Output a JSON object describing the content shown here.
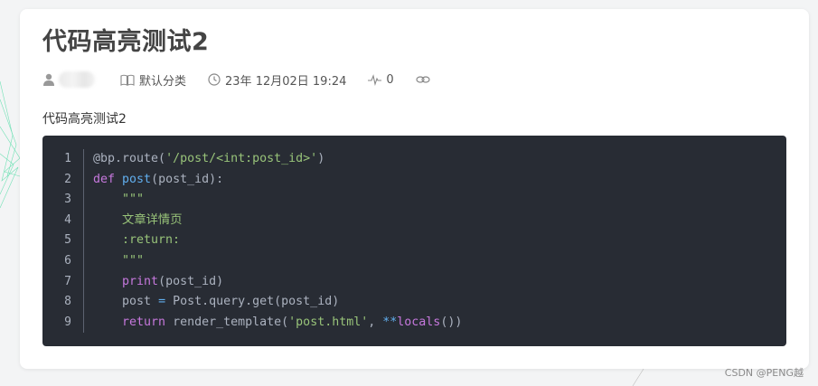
{
  "article": {
    "title": "代码高亮测试2",
    "summary": "代码高亮测试2"
  },
  "meta": {
    "category": "默认分类",
    "datetime": "23年 12月02日 19:24",
    "views": "0"
  },
  "code": {
    "line_numbers": [
      "1",
      "2",
      "3",
      "4",
      "5",
      "6",
      "7",
      "8",
      "9"
    ],
    "lines": [
      [
        {
          "t": "@bp.route(",
          "c": "default"
        },
        {
          "t": "'/post/<int:post_id>'",
          "c": "string"
        },
        {
          "t": ")",
          "c": "default"
        }
      ],
      [
        {
          "t": "def ",
          "c": "keyword"
        },
        {
          "t": "post",
          "c": "func"
        },
        {
          "t": "(post_id):",
          "c": "default"
        }
      ],
      [
        {
          "t": "    \"\"\"",
          "c": "string"
        }
      ],
      [
        {
          "t": "    文章详情页",
          "c": "string"
        }
      ],
      [
        {
          "t": "    :return:",
          "c": "string"
        }
      ],
      [
        {
          "t": "    \"\"\"",
          "c": "string"
        }
      ],
      [
        {
          "t": "    ",
          "c": "default"
        },
        {
          "t": "print",
          "c": "builtin"
        },
        {
          "t": "(post_id)",
          "c": "default"
        }
      ],
      [
        {
          "t": "    post ",
          "c": "default"
        },
        {
          "t": "=",
          "c": "op"
        },
        {
          "t": " Post.query.get(post_id)",
          "c": "default"
        }
      ],
      [
        {
          "t": "    ",
          "c": "default"
        },
        {
          "t": "return",
          "c": "keyword"
        },
        {
          "t": " render_template(",
          "c": "default"
        },
        {
          "t": "'post.html'",
          "c": "string"
        },
        {
          "t": ", ",
          "c": "default"
        },
        {
          "t": "**",
          "c": "op"
        },
        {
          "t": "locals",
          "c": "builtin"
        },
        {
          "t": "())",
          "c": "default"
        }
      ]
    ]
  },
  "watermark": "CSDN @PENG越",
  "icons": {
    "author": "user-icon",
    "category": "book-icon",
    "datetime": "clock-icon",
    "views": "pulse-icon",
    "link": "link-icon"
  },
  "colors": {
    "code_bg": "#282c34",
    "keyword": "#c678dd",
    "function": "#61aeee",
    "string": "#98c379",
    "text": "#abb2bf"
  }
}
